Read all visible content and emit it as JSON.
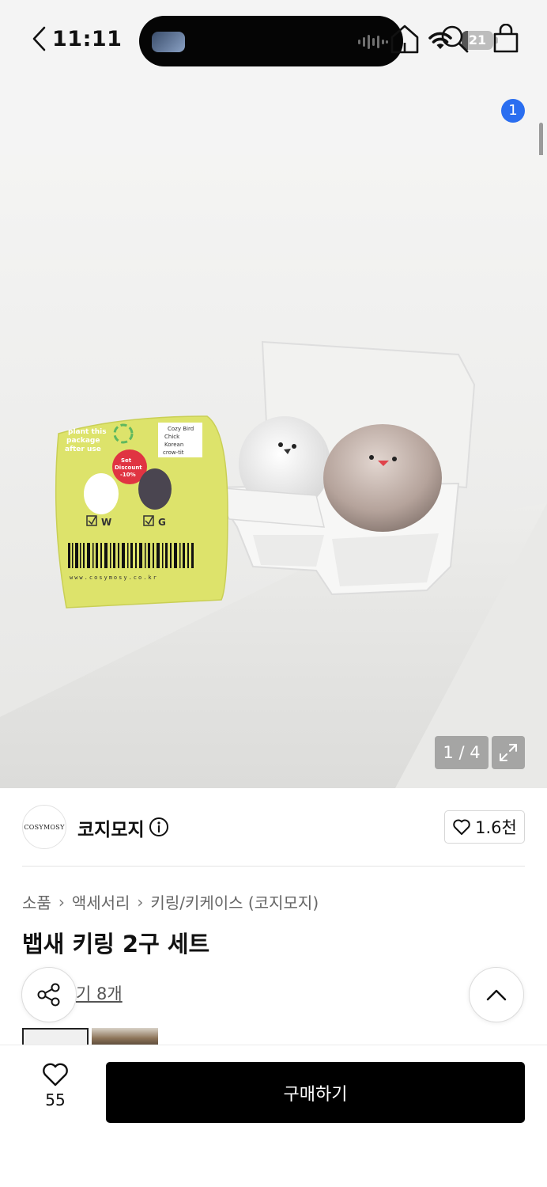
{
  "status_bar": {
    "time": "11:11",
    "battery": "21",
    "battery_level": 0.21
  },
  "nav": {
    "cart_count": "1",
    "badge_color": "#2a6ef0"
  },
  "image": {
    "counter": "1 / 4",
    "label_text": {
      "plant_note": "plant this package after use",
      "tag_note": "Cozy Bird Chick Korean crow-tit",
      "discount": "Set Discount -10%",
      "option_w": "W",
      "option_g": "G",
      "url": "www.cosymosy.co.kr"
    }
  },
  "brand": {
    "logo_text": "COSYMOSY",
    "name": "코지모지",
    "like_count": "1.6천"
  },
  "breadcrumb": [
    "소품",
    "액세서리",
    "키링/키케이스 (코지모지)"
  ],
  "product": {
    "title": "뱁새 키링 2구 세트",
    "review_link": "기 8개"
  },
  "bottom_bar": {
    "wish_count": "55",
    "buy_label": "구매하기"
  },
  "icons": [
    "back-icon",
    "home-icon",
    "search-icon",
    "cart-icon",
    "info-icon",
    "heart-icon",
    "share-icon",
    "chevron-up-icon",
    "expand-icon",
    "wifi-icon",
    "battery-icon"
  ]
}
